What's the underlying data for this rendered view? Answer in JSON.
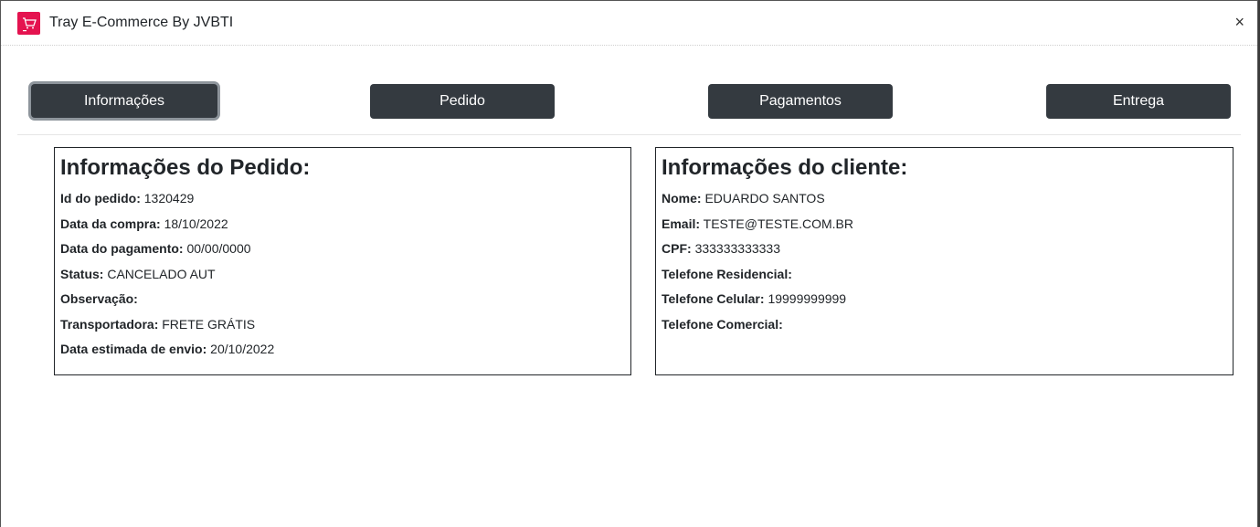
{
  "window": {
    "title": "Tray E-Commerce By JVBTI",
    "close_label": "×",
    "icon": "shopping-cart-icon",
    "icon_color": "#e4134f"
  },
  "tabs": [
    {
      "label": "Informações",
      "active": true
    },
    {
      "label": "Pedido",
      "active": false
    },
    {
      "label": "Pagamentos",
      "active": false
    },
    {
      "label": "Entrega",
      "active": false
    }
  ],
  "order_info": {
    "heading": "Informações do Pedido:",
    "fields": [
      {
        "label": "Id do pedido:",
        "value": "1320429"
      },
      {
        "label": "Data da compra:",
        "value": "18/10/2022"
      },
      {
        "label": "Data do pagamento:",
        "value": "00/00/0000"
      },
      {
        "label": "Status:",
        "value": "CANCELADO AUT"
      },
      {
        "label": "Observação:",
        "value": ""
      },
      {
        "label": "Transportadora:",
        "value": "FRETE GRÁTIS"
      },
      {
        "label": "Data estimada de envio:",
        "value": "20/10/2022"
      }
    ]
  },
  "client_info": {
    "heading": "Informações do cliente:",
    "fields": [
      {
        "label": "Nome:",
        "value": "EDUARDO SANTOS"
      },
      {
        "label": "Email:",
        "value": "TESTE@TESTE.COM.BR"
      },
      {
        "label": "CPF:",
        "value": "333333333333"
      },
      {
        "label": "Telefone Residencial:",
        "value": ""
      },
      {
        "label": "Telefone Celular:",
        "value": "19999999999"
      },
      {
        "label": "Telefone Comercial:",
        "value": ""
      }
    ]
  },
  "colors": {
    "tab_bg": "#343a40",
    "tab_text": "#ffffff",
    "accent": "#e4134f"
  }
}
